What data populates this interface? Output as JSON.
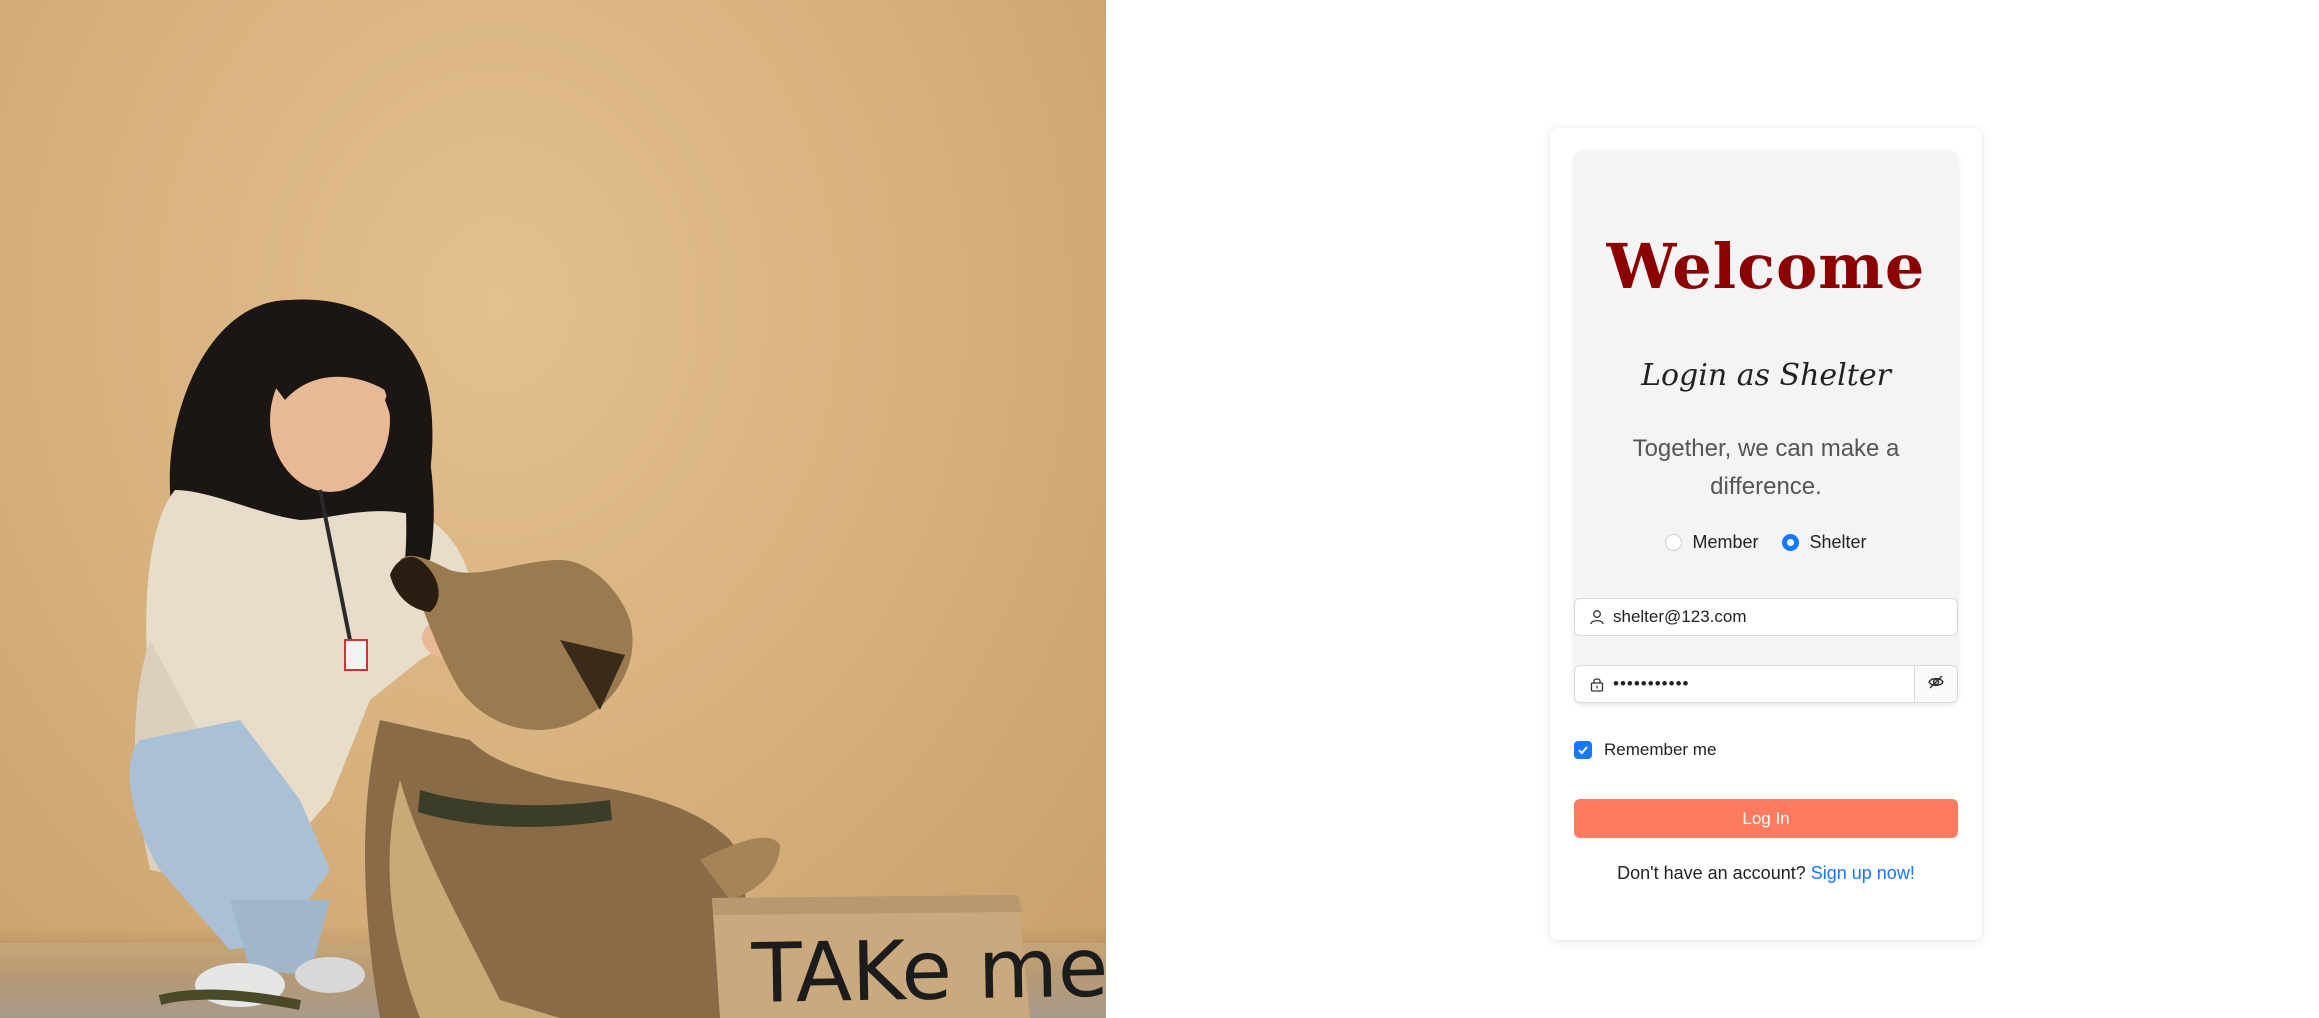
{
  "hero": {
    "sign_text": "TAKe me"
  },
  "login": {
    "title": "Welcome",
    "subtitle": "Login as Shelter",
    "tagline": "Together, we can make a difference.",
    "role_options": [
      {
        "label": "Member",
        "selected": false
      },
      {
        "label": "Shelter",
        "selected": true
      }
    ],
    "email_value": "shelter@123.com",
    "email_icon": "user-icon",
    "password_value": "•••••••••••",
    "password_icon": "lock-icon",
    "password_toggle_icon": "eye-invisible-icon",
    "remember_label": "Remember me",
    "remember_checked": true,
    "login_button": "Log In",
    "no_account_text": "Don't have an account?",
    "signup_link": "Sign up now!"
  },
  "colors": {
    "title": "#8b0000",
    "accent": "#1677ff",
    "button": "#ff7b5f",
    "hero_bg": "#d8b27f"
  }
}
